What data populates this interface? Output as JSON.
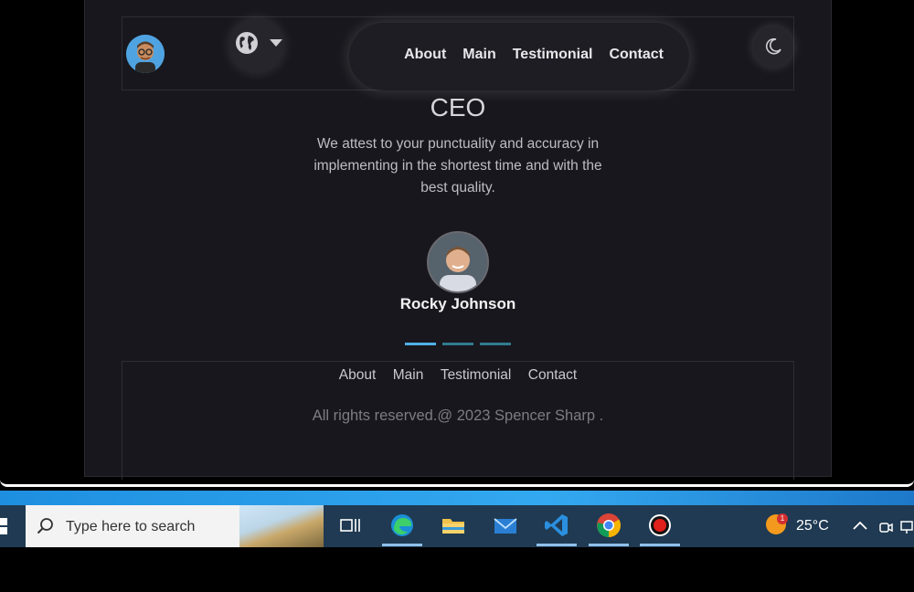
{
  "nav": {
    "links": [
      "About",
      "Main",
      "Testimonial",
      "Contact"
    ]
  },
  "testimonial": {
    "title": "CEO",
    "quote": "We attest to your punctuality and accuracy in implementing in the shortest time and with the best quality.",
    "name": "Rocky Johnson",
    "slides": 3,
    "active_slide": 1
  },
  "footer": {
    "links": [
      "About",
      "Main",
      "Testimonial",
      "Contact"
    ],
    "copyright": "All rights reserved.@ 2023 Spencer Sharp ."
  },
  "taskbar": {
    "search_placeholder": "Type here to search",
    "apps": [
      "task-view",
      "edge",
      "file-explorer",
      "mail",
      "vscode",
      "chrome",
      "recorder"
    ],
    "weather_badge": "1",
    "temperature": "25°C"
  },
  "colors": {
    "page_bg": "#18171d",
    "accent": "#4fb0e8",
    "taskbar": "#1f3a52"
  }
}
